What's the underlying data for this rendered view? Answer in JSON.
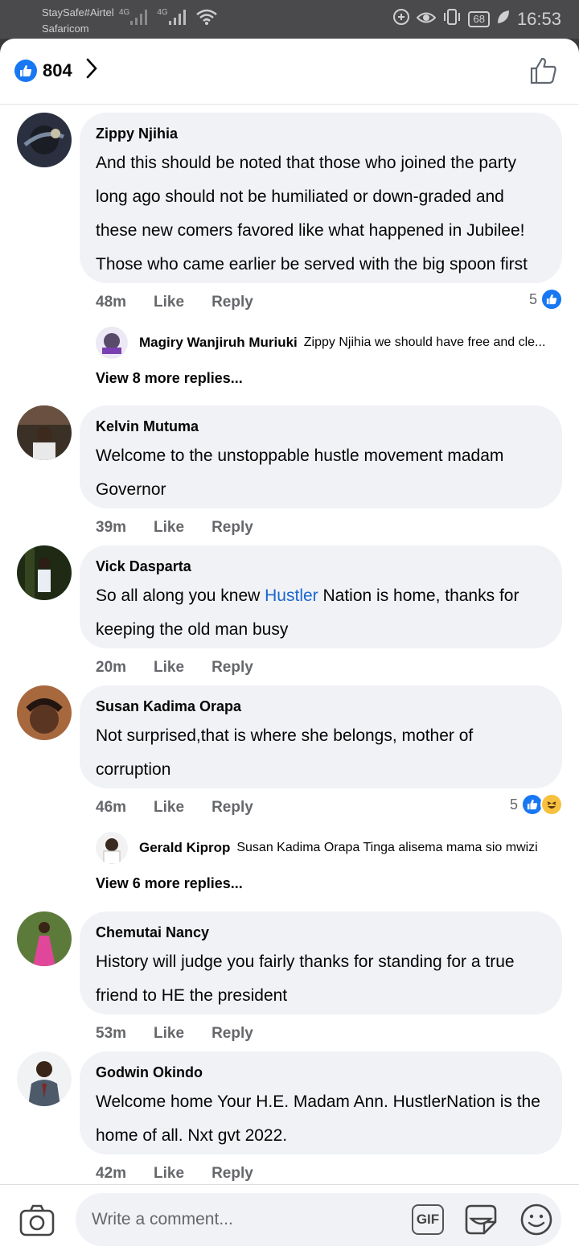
{
  "status_bar": {
    "carrier_line1": "StaySafe#Airtel",
    "carrier_line2": "Safaricom",
    "signal1_label": "4G",
    "signal2_label": "4G",
    "battery": "68",
    "time": "16:53"
  },
  "header": {
    "like_count": "804"
  },
  "comments": [
    {
      "author": "Zippy Njihia",
      "text": "And this should be noted that those who joined the party long ago should not be humiliated or down-graded and these new comers favored like what happened in Jubilee! Those who came earlier be served with the big spoon first",
      "time": "48m",
      "like": "Like",
      "reply": "Reply",
      "reaction_count": "5",
      "preview_reply": {
        "author": "Magiry Wanjiruh Muriuki",
        "text": "Zippy Njihia we should have free and cle..."
      },
      "more_replies": "View 8 more replies..."
    },
    {
      "author": "Kelvin Mutuma",
      "text": "Welcome to the unstoppable hustle movement madam Governor",
      "time": "39m",
      "like": "Like",
      "reply": "Reply"
    },
    {
      "author": "Vick Dasparta",
      "text_before": "So all along you knew ",
      "text_link": "Hustler",
      "text_after": " Nation is home, thanks for keeping the old man busy",
      "time": "20m",
      "like": "Like",
      "reply": "Reply"
    },
    {
      "author": "Susan Kadima Orapa",
      "text": "Not surprised,that is where she belongs, mother of corruption",
      "time": "46m",
      "like": "Like",
      "reply": "Reply",
      "reaction_count": "5",
      "preview_reply": {
        "author": "Gerald Kiprop",
        "text": "Susan Kadima Orapa  Tinga alisema mama sio mwizi"
      },
      "more_replies": "View 6 more replies..."
    },
    {
      "author": "Chemutai Nancy",
      "text": "History will judge you fairly  thanks for standing for a true friend to HE the president",
      "time": "53m",
      "like": "Like",
      "reply": "Reply"
    },
    {
      "author": "Godwin Okindo",
      "text": "Welcome home Your H.E. Madam Ann. HustlerNation is the home of all. Nxt gvt 2022.",
      "time": "42m",
      "like": "Like",
      "reply": "Reply"
    }
  ],
  "composer": {
    "placeholder": "Write a comment...",
    "gif_label": "GIF"
  },
  "colors": {
    "accent": "#1877f2",
    "bubble": "#f0f2f5",
    "meta_text": "#65676b",
    "link": "#1a66d1"
  },
  "icons": [
    "like-icon",
    "chevron-right-icon",
    "thumbs-up-outline-icon",
    "camera-icon",
    "sticker-icon",
    "emoji-icon",
    "haha-icon"
  ]
}
